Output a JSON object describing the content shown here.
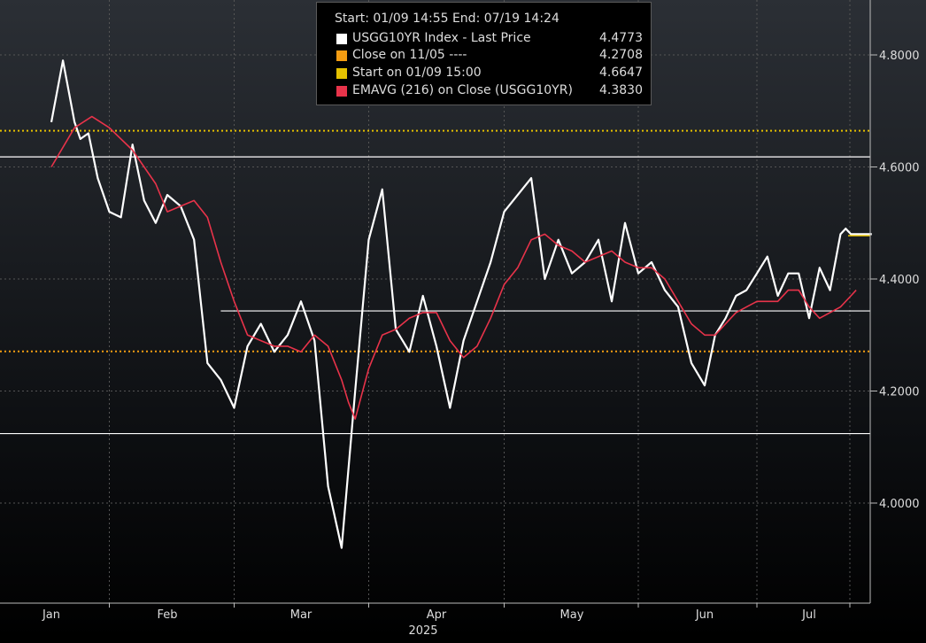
{
  "chart_data": {
    "type": "line",
    "title": "",
    "year_label": "2025",
    "x_categories": [
      "Jan",
      "Feb",
      "Mar",
      "Apr",
      "May",
      "Jun",
      "Jul"
    ],
    "y_axis": {
      "side": "right",
      "ylim": [
        3.85,
        4.84
      ],
      "ticks": [
        "4.8000",
        "4.6000",
        "4.4000",
        "4.2000",
        "4.0000"
      ],
      "tick_values": [
        4.8,
        4.6,
        4.4,
        4.2,
        4.0
      ]
    },
    "grid": true,
    "legend": {
      "placement": "top-center",
      "header": "Start: 01/09 14:55 End: 07/19 14:24",
      "entries": [
        {
          "label": "USGG10YR Index - Last Price",
          "value": "4.4773",
          "color": "#ffffff"
        },
        {
          "label": "Close on 11/05 ----",
          "value": "4.2708",
          "color": "#f39c12"
        },
        {
          "label": "Start on 01/09 15:00",
          "value": "4.6647",
          "color": "#e5c100"
        },
        {
          "label": "EMAVG (216)  on Close (USGG10YR)",
          "value": "4.3830",
          "color": "#e8334a"
        }
      ]
    },
    "series": [
      {
        "name": "USGG10YR Index - Last Price",
        "color": "#ffffff",
        "x": [
          0,
          0.1,
          0.2,
          0.25,
          0.32,
          0.4,
          0.5,
          0.6,
          0.7,
          0.8,
          0.9,
          1.0,
          1.1,
          1.2,
          1.3,
          1.4,
          1.5,
          1.6,
          1.7,
          1.8,
          1.9,
          2.0,
          2.1,
          2.2,
          2.3,
          2.4,
          2.5,
          2.6,
          2.7,
          2.8,
          2.9,
          3.0,
          3.1,
          3.2,
          3.3,
          3.4,
          3.5,
          3.6,
          3.7,
          3.8,
          3.9,
          4.0,
          4.1,
          4.2,
          4.3,
          4.4,
          4.5,
          4.6,
          4.7,
          4.8,
          4.9,
          5.0,
          5.1,
          5.2,
          5.3,
          5.4,
          5.5,
          5.6,
          5.7,
          5.8,
          5.9,
          6.0,
          6.1,
          6.2,
          6.3,
          6.35,
          6.4,
          6.45,
          6.6
        ],
        "values": [
          4.68,
          4.79,
          4.68,
          4.65,
          4.66,
          4.58,
          4.52,
          4.51,
          4.64,
          4.54,
          4.5,
          4.55,
          4.53,
          4.47,
          4.25,
          4.22,
          4.17,
          4.28,
          4.32,
          4.27,
          4.3,
          4.36,
          4.29,
          4.03,
          3.92,
          4.2,
          4.47,
          4.56,
          4.31,
          4.27,
          4.37,
          4.28,
          4.17,
          4.29,
          4.36,
          4.43,
          4.52,
          4.55,
          4.58,
          4.4,
          4.47,
          4.41,
          4.43,
          4.47,
          4.36,
          4.5,
          4.41,
          4.43,
          4.38,
          4.35,
          4.25,
          4.21,
          4.3,
          4.33,
          4.37,
          4.38,
          4.41,
          4.44,
          4.37,
          4.41,
          4.41,
          4.33,
          4.42,
          4.38,
          4.48,
          4.49,
          4.48,
          4.48,
          4.48
        ]
      },
      {
        "name": "EMAVG (216)  on Close (USGG10YR)",
        "color": "#e8334a",
        "x": [
          0,
          0.2,
          0.35,
          0.5,
          0.7,
          0.9,
          1.0,
          1.1,
          1.2,
          1.3,
          1.4,
          1.5,
          1.6,
          1.7,
          1.8,
          1.9,
          2.0,
          2.1,
          2.2,
          2.3,
          2.35,
          2.4,
          2.5,
          2.6,
          2.7,
          2.8,
          2.9,
          3.0,
          3.1,
          3.2,
          3.3,
          3.4,
          3.5,
          3.6,
          3.7,
          3.8,
          3.9,
          4.0,
          4.1,
          4.2,
          4.3,
          4.4,
          4.5,
          4.6,
          4.7,
          4.8,
          4.9,
          5.0,
          5.1,
          5.2,
          5.3,
          5.4,
          5.5,
          5.6,
          5.7,
          5.8,
          5.9,
          6.0,
          6.1,
          6.2,
          6.3,
          6.4,
          6.45
        ],
        "values": [
          4.6,
          4.67,
          4.69,
          4.67,
          4.63,
          4.57,
          4.52,
          4.53,
          4.54,
          4.51,
          4.43,
          4.36,
          4.3,
          4.29,
          4.28,
          4.28,
          4.27,
          4.3,
          4.28,
          4.22,
          4.18,
          4.15,
          4.24,
          4.3,
          4.31,
          4.33,
          4.34,
          4.34,
          4.29,
          4.26,
          4.28,
          4.33,
          4.39,
          4.42,
          4.47,
          4.48,
          4.46,
          4.45,
          4.43,
          4.44,
          4.45,
          4.43,
          4.42,
          4.42,
          4.4,
          4.36,
          4.32,
          4.3,
          4.3,
          4.32,
          4.34,
          4.35,
          4.36,
          4.36,
          4.36,
          4.38,
          4.38,
          4.35,
          4.33,
          4.34,
          4.35,
          4.37,
          4.38
        ]
      }
    ],
    "reference_lines": [
      {
        "name": "Start on 01/09 15:00",
        "y": 4.6647,
        "color": "#e5c100",
        "style": "dotted"
      },
      {
        "name": "Close on 11/05 ----",
        "y": 4.2708,
        "color": "#f39c12",
        "style": "dotted"
      },
      {
        "y": 4.618,
        "color": "#ffffff",
        "style": "solid",
        "x_start": 0
      },
      {
        "y": 4.343,
        "color": "#ffffff",
        "style": "solid",
        "x_start": 1.4
      },
      {
        "y": 4.124,
        "color": "#ffffff",
        "style": "solid",
        "x_start": 0
      }
    ],
    "last_price_marker": {
      "y": 4.4773,
      "color": "#e5c100"
    }
  }
}
